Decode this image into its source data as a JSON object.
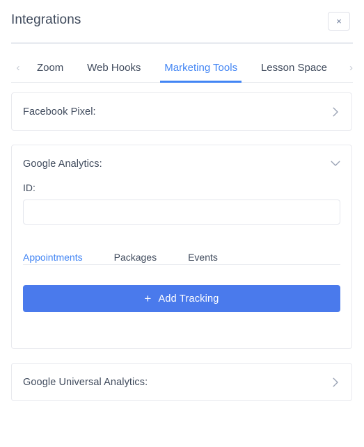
{
  "header": {
    "title": "Integrations",
    "close_label": "×"
  },
  "tabs": {
    "prev_arrow": "‹",
    "next_arrow": "›",
    "items": [
      {
        "label": "Zoom",
        "active": false
      },
      {
        "label": "Web Hooks",
        "active": false
      },
      {
        "label": "Marketing Tools",
        "active": true
      },
      {
        "label": "Lesson Space",
        "active": false
      }
    ],
    "active_color": "#4285f4"
  },
  "cards": [
    {
      "title": "Facebook Pixel:",
      "expanded": false,
      "chevron": "chevron-right-icon"
    },
    {
      "title": "Google Analytics:",
      "expanded": true,
      "chevron": "chevron-down-icon",
      "field": {
        "label": "ID:",
        "value": "",
        "placeholder": ""
      },
      "subtabs": [
        {
          "label": "Appointments",
          "active": true
        },
        {
          "label": "Packages",
          "active": false
        },
        {
          "label": "Events",
          "active": false
        }
      ],
      "button": {
        "icon": "plus-icon",
        "label": "Add Tracking",
        "color": "#4a7aec"
      }
    },
    {
      "title": "Google Universal Analytics:",
      "expanded": false,
      "chevron": "chevron-right-icon"
    }
  ]
}
